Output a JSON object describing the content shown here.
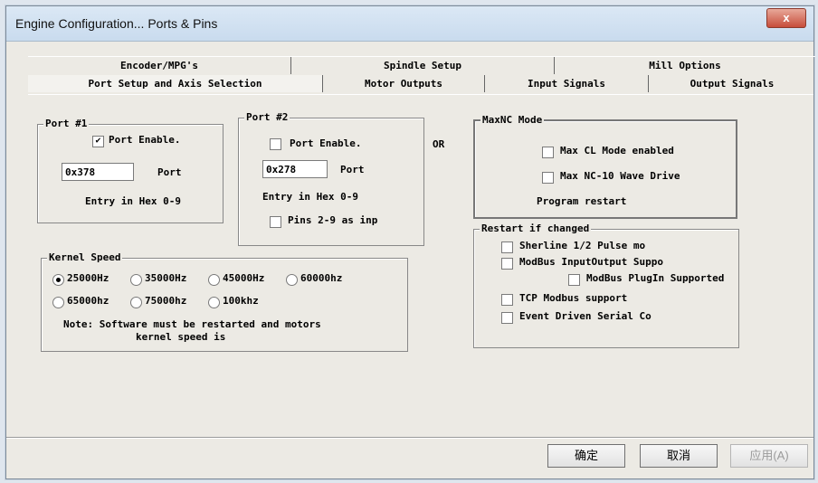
{
  "window": {
    "title": "Engine Configuration... Ports & Pins",
    "close_label": "x"
  },
  "tabs_row1": [
    {
      "label": "Encoder/MPG's"
    },
    {
      "label": "Spindle Setup"
    },
    {
      "label": "Mill Options"
    }
  ],
  "tabs_row2": [
    {
      "label": "Port Setup and Axis Selection"
    },
    {
      "label": "Motor Outputs"
    },
    {
      "label": "Input Signals"
    },
    {
      "label": "Output Signals"
    }
  ],
  "port1": {
    "legend": "Port #1",
    "enable_label": "Port Enable.",
    "enable_checked": true,
    "address_value": "0x378",
    "address_label": "Port",
    "hint": "Entry in Hex 0-9"
  },
  "port2": {
    "legend": "Port #2",
    "enable_label": "Port Enable.",
    "enable_checked": false,
    "address_value": "0x278",
    "address_label": "Port",
    "hint": "Entry in Hex 0-9",
    "pins_label": "Pins 2-9 as inp",
    "pins_checked": false
  },
  "or_label": "OR",
  "maxnc": {
    "legend": "MaxNC Mode",
    "cl_label": "Max CL Mode enabled",
    "nc10_label": "Max NC-10 Wave Drive",
    "note": "Program restart"
  },
  "kernel": {
    "legend": "Kernel Speed",
    "options": [
      {
        "label": "25000Hz",
        "selected": true
      },
      {
        "label": "35000Hz",
        "selected": false
      },
      {
        "label": "45000Hz",
        "selected": false
      },
      {
        "label": "60000hz",
        "selected": false
      },
      {
        "label": "65000hz",
        "selected": false
      },
      {
        "label": "75000hz",
        "selected": false
      },
      {
        "label": "100khz",
        "selected": false
      }
    ],
    "note1": "Note: Software must be restarted and motors",
    "note2": "kernel speed is"
  },
  "restart": {
    "legend": "Restart if changed",
    "items": [
      {
        "label": "Sherline 1/2 Pulse mo"
      },
      {
        "label": "ModBus InputOutput Suppo"
      },
      {
        "label": "ModBus PlugIn Supported"
      },
      {
        "label": "TCP Modbus support"
      },
      {
        "label": "Event Driven Serial Co"
      }
    ]
  },
  "buttons": {
    "ok": "确定",
    "cancel": "取消",
    "apply": "应用(A)"
  }
}
